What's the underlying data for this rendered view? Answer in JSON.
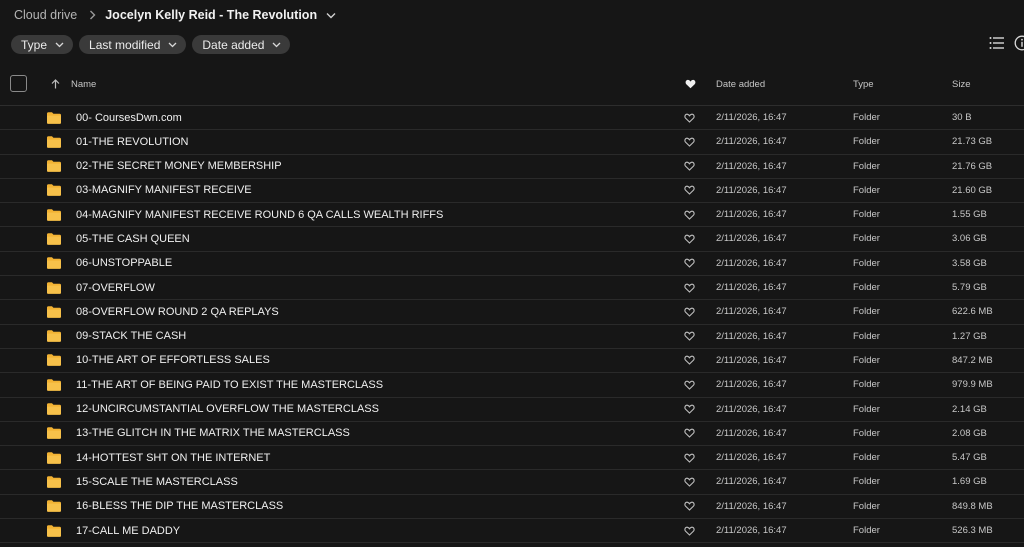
{
  "breadcrumb": {
    "root": "Cloud drive",
    "current": "Jocelyn Kelly Reid - The Revolution"
  },
  "filters": {
    "type": "Type",
    "last_modified": "Last modified",
    "date_added": "Date added"
  },
  "columns": {
    "name": "Name",
    "date_added": "Date added",
    "type": "Type",
    "size": "Size"
  },
  "icons": {
    "folder": "folder-icon",
    "favorite": "heart-icon",
    "sort": "arrow-up-icon",
    "view": "list-view-icon",
    "info": "info-icon"
  },
  "colors": {
    "folder": "#f2b233",
    "background": "#161616"
  },
  "rows": [
    {
      "name": "00- CoursesDwn.com",
      "date": "2/11/2026, 16:47",
      "type": "Folder",
      "size": "30 B"
    },
    {
      "name": "01-THE REVOLUTION",
      "date": "2/11/2026, 16:47",
      "type": "Folder",
      "size": "21.73 GB"
    },
    {
      "name": "02-THE SECRET MONEY MEMBERSHIP",
      "date": "2/11/2026, 16:47",
      "type": "Folder",
      "size": "21.76 GB"
    },
    {
      "name": "03-MAGNIFY MANIFEST RECEIVE",
      "date": "2/11/2026, 16:47",
      "type": "Folder",
      "size": "21.60 GB"
    },
    {
      "name": "04-MAGNIFY MANIFEST RECEIVE ROUND 6 QA CALLS WEALTH RIFFS",
      "date": "2/11/2026, 16:47",
      "type": "Folder",
      "size": "1.55 GB"
    },
    {
      "name": "05-THE CASH QUEEN",
      "date": "2/11/2026, 16:47",
      "type": "Folder",
      "size": "3.06 GB"
    },
    {
      "name": "06-UNSTOPPABLE",
      "date": "2/11/2026, 16:47",
      "type": "Folder",
      "size": "3.58 GB"
    },
    {
      "name": "07-OVERFLOW",
      "date": "2/11/2026, 16:47",
      "type": "Folder",
      "size": "5.79 GB"
    },
    {
      "name": "08-OVERFLOW ROUND 2 QA REPLAYS",
      "date": "2/11/2026, 16:47",
      "type": "Folder",
      "size": "622.6 MB"
    },
    {
      "name": "09-STACK THE CASH",
      "date": "2/11/2026, 16:47",
      "type": "Folder",
      "size": "1.27 GB"
    },
    {
      "name": "10-THE ART OF EFFORTLESS SALES",
      "date": "2/11/2026, 16:47",
      "type": "Folder",
      "size": "847.2 MB"
    },
    {
      "name": "11-THE ART OF BEING PAID TO EXIST THE MASTERCLASS",
      "date": "2/11/2026, 16:47",
      "type": "Folder",
      "size": "979.9 MB"
    },
    {
      "name": "12-UNCIRCUMSTANTIAL OVERFLOW THE MASTERCLASS",
      "date": "2/11/2026, 16:47",
      "type": "Folder",
      "size": "2.14 GB"
    },
    {
      "name": "13-THE GLITCH IN THE MATRIX THE MASTERCLASS",
      "date": "2/11/2026, 16:47",
      "type": "Folder",
      "size": "2.08 GB"
    },
    {
      "name": "14-HOTTEST SHT ON THE INTERNET",
      "date": "2/11/2026, 16:47",
      "type": "Folder",
      "size": "5.47 GB"
    },
    {
      "name": "15-SCALE THE MASTERCLASS",
      "date": "2/11/2026, 16:47",
      "type": "Folder",
      "size": "1.69 GB"
    },
    {
      "name": "16-BLESS THE DIP THE MASTERCLASS",
      "date": "2/11/2026, 16:47",
      "type": "Folder",
      "size": "849.8 MB"
    },
    {
      "name": "17-CALL ME DADDY",
      "date": "2/11/2026, 16:47",
      "type": "Folder",
      "size": "526.3 MB"
    }
  ]
}
